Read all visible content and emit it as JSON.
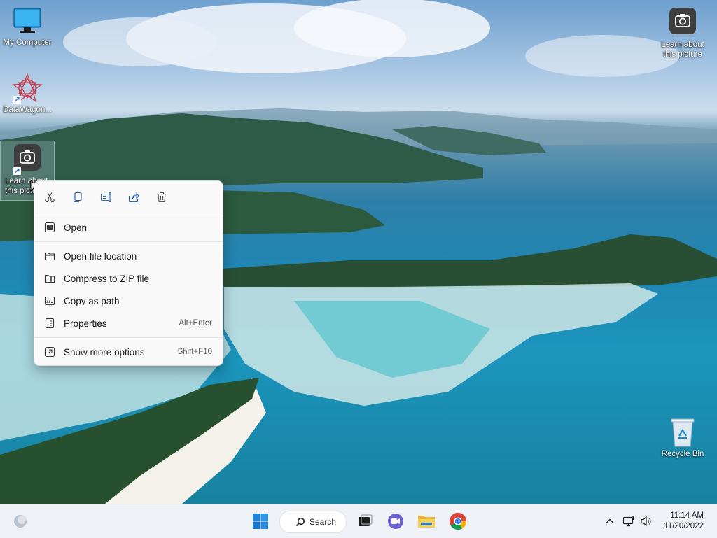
{
  "desktop": {
    "icons": [
      {
        "label": "My Computer",
        "icon": "monitor-icon"
      },
      {
        "label": "DataWagon...",
        "icon": "datawagon-icon",
        "shortcut": true
      },
      {
        "label": "Learn about this picture",
        "icon": "camera-icon",
        "shortcut": true,
        "selected": true,
        "label_visible": "Learn a\nthis pic"
      },
      {
        "label": "Learn about this picture",
        "icon": "camera-icon"
      },
      {
        "label": "Recycle Bin",
        "icon": "recycle-bin-icon"
      }
    ]
  },
  "context_menu": {
    "actions": [
      {
        "name": "cut",
        "icon": "scissors-icon"
      },
      {
        "name": "copy",
        "icon": "copy-icon"
      },
      {
        "name": "rename",
        "icon": "rename-icon"
      },
      {
        "name": "share",
        "icon": "share-icon"
      },
      {
        "name": "delete",
        "icon": "trash-icon"
      }
    ],
    "items": [
      {
        "label": "Open",
        "shortcut": "",
        "icon": "open-icon"
      },
      {
        "label": "Open file location",
        "shortcut": "",
        "icon": "folder-icon"
      },
      {
        "label": "Compress to ZIP file",
        "shortcut": "",
        "icon": "zip-icon"
      },
      {
        "label": "Copy as path",
        "shortcut": "",
        "icon": "path-icon"
      },
      {
        "label": "Properties",
        "shortcut": "Alt+Enter",
        "icon": "properties-icon"
      },
      {
        "label": "Show more options",
        "shortcut": "Shift+F10",
        "icon": "more-options-icon"
      }
    ]
  },
  "taskbar": {
    "search_label": "Search",
    "apps": [
      "start-icon",
      "task-view-icon",
      "chat-icon",
      "file-explorer-icon",
      "chrome-icon"
    ],
    "tray": {
      "time": "11:14 AM",
      "date": "11/20/2022",
      "icons": [
        "chevron-up-icon",
        "network-icon",
        "volume-icon"
      ]
    }
  }
}
